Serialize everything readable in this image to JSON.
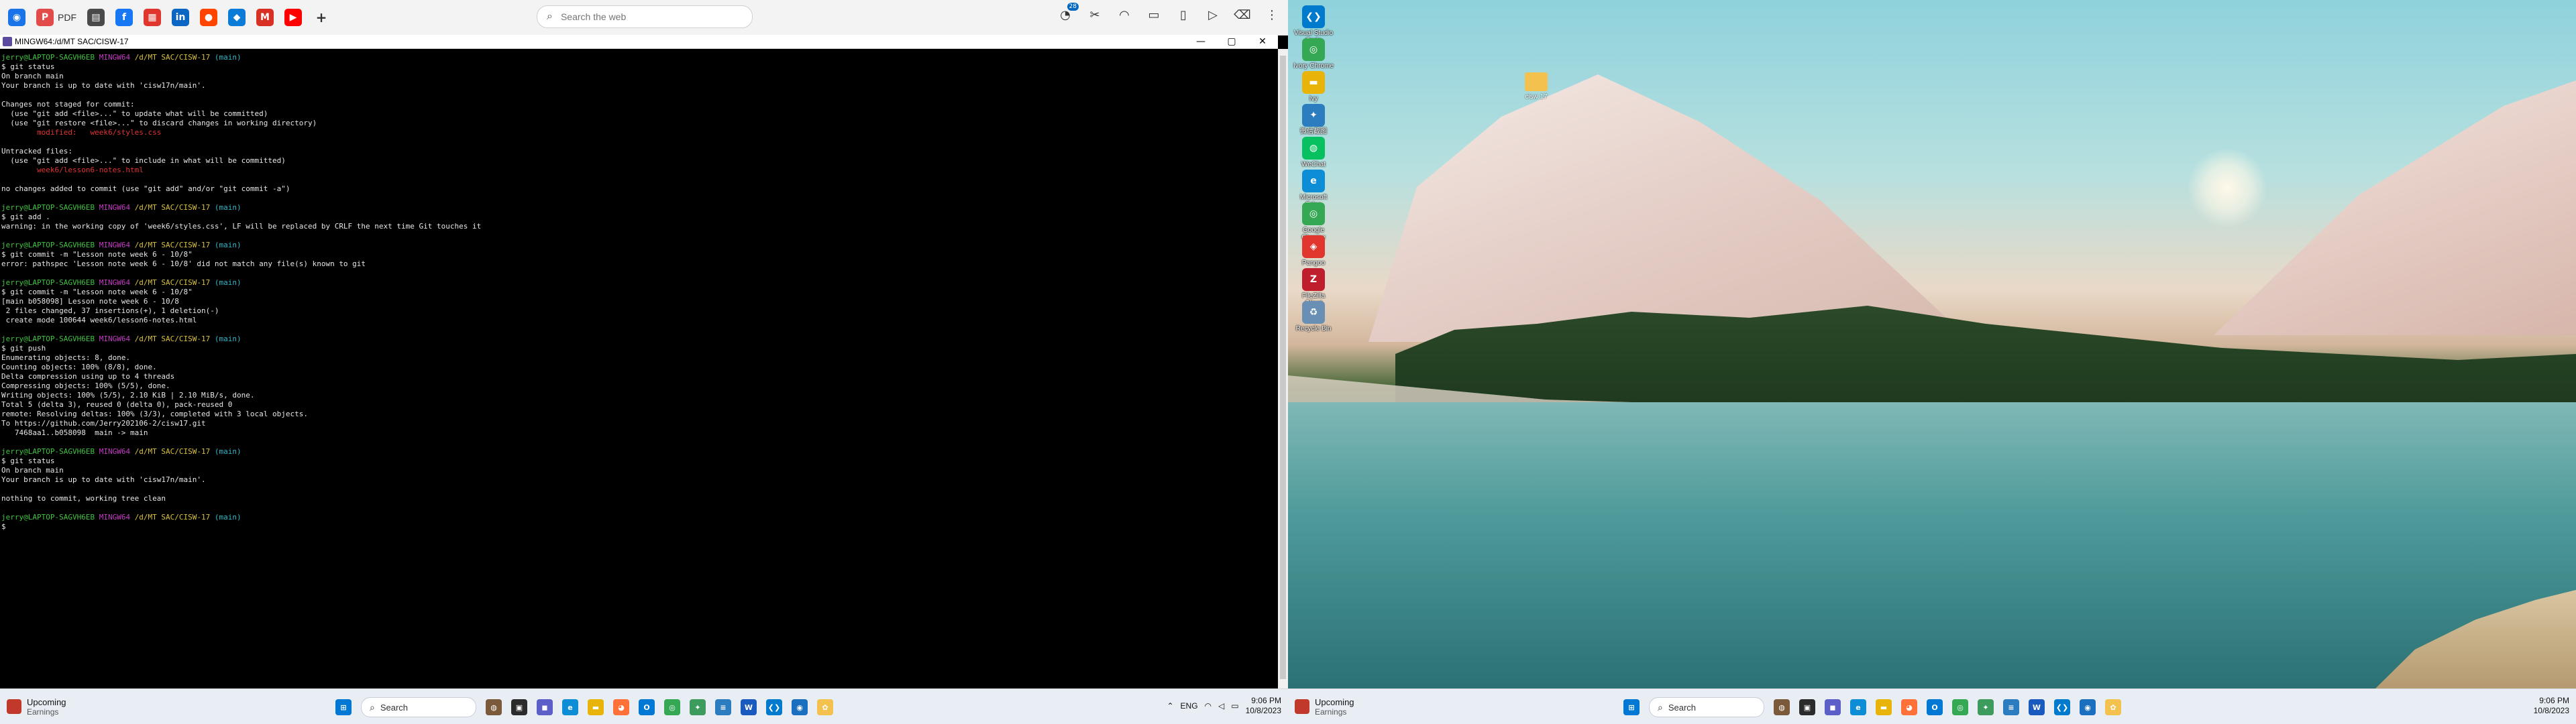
{
  "left_monitor": {
    "topbar": {
      "app_icons": [
        {
          "name": "circle-app-icon",
          "glyph": "◉",
          "color": "#1a73e8"
        },
        {
          "name": "pdf-icon",
          "glyph": "P",
          "color": "#e34b4b"
        },
        {
          "name": "sidebar-icon",
          "glyph": "▤",
          "color": "#4a4a4a"
        },
        {
          "name": "facebook-icon",
          "glyph": "f",
          "color": "#1877f2"
        },
        {
          "name": "news-icon",
          "glyph": "▦",
          "color": "#e0362d"
        },
        {
          "name": "linkedin-icon",
          "glyph": "in",
          "color": "#0a66c2"
        },
        {
          "name": "reddit-icon",
          "glyph": "●",
          "color": "#ff4500"
        },
        {
          "name": "blue-app-icon",
          "glyph": "◆",
          "color": "#0b7bd8"
        },
        {
          "name": "gmail-icon",
          "glyph": "M",
          "color": "#d93025"
        },
        {
          "name": "youtube-icon",
          "glyph": "▶",
          "color": "#ff0000"
        }
      ],
      "pdf_label": "PDF",
      "add_tab_glyph": "+",
      "search": {
        "placeholder": "Search the web"
      },
      "notification_count": "28"
    },
    "terminal": {
      "title": "MINGW64:/d/MT SAC/CISW-17",
      "controls": [
        "—",
        "▢",
        "✕"
      ],
      "prompt_user": "jerry@LAPTOP-SAGVH6EB",
      "prompt_shell": "MINGW64",
      "prompt_path": "/d/MT SAC/CISW-17",
      "prompt_branch": "(main)",
      "lines": [
        {
          "type": "prompt"
        },
        {
          "type": "out",
          "text": "$ git status"
        },
        {
          "type": "out",
          "text": "On branch main"
        },
        {
          "type": "out",
          "text": "Your branch is up to date with 'cisw17n/main'."
        },
        {
          "type": "out",
          "text": ""
        },
        {
          "type": "out",
          "text": "Changes not staged for commit:"
        },
        {
          "type": "out",
          "text": "  (use \"git add <file>...\" to update what will be committed)"
        },
        {
          "type": "out",
          "text": "  (use \"git restore <file>...\" to discard changes in working directory)"
        },
        {
          "type": "red",
          "text": "        modified:   week6/styles.css"
        },
        {
          "type": "out",
          "text": ""
        },
        {
          "type": "out",
          "text": "Untracked files:"
        },
        {
          "type": "out",
          "text": "  (use \"git add <file>...\" to include in what will be committed)"
        },
        {
          "type": "red",
          "text": "        week6/lesson6-notes.html"
        },
        {
          "type": "out",
          "text": ""
        },
        {
          "type": "out",
          "text": "no changes added to commit (use \"git add\" and/or \"git commit -a\")"
        },
        {
          "type": "out",
          "text": ""
        },
        {
          "type": "prompt"
        },
        {
          "type": "out",
          "text": "$ git add ."
        },
        {
          "type": "out",
          "text": "warning: in the working copy of 'week6/styles.css', LF will be replaced by CRLF the next time Git touches it"
        },
        {
          "type": "out",
          "text": ""
        },
        {
          "type": "prompt"
        },
        {
          "type": "out",
          "text": "$ git commit -m \"Lesson note week 6 - 10/8\""
        },
        {
          "type": "out",
          "text": "error: pathspec 'Lesson note week 6 - 10/8' did not match any file(s) known to git"
        },
        {
          "type": "out",
          "text": ""
        },
        {
          "type": "prompt"
        },
        {
          "type": "out",
          "text": "$ git commit -m \"Lesson note week 6 - 10/8\""
        },
        {
          "type": "out",
          "text": "[main b058098] Lesson note week 6 - 10/8"
        },
        {
          "type": "out",
          "text": " 2 files changed, 37 insertions(+), 1 deletion(-)"
        },
        {
          "type": "out",
          "text": " create mode 100644 week6/lesson6-notes.html"
        },
        {
          "type": "out",
          "text": ""
        },
        {
          "type": "prompt"
        },
        {
          "type": "out",
          "text": "$ git push"
        },
        {
          "type": "out",
          "text": "Enumerating objects: 8, done."
        },
        {
          "type": "out",
          "text": "Counting objects: 100% (8/8), done."
        },
        {
          "type": "out",
          "text": "Delta compression using up to 4 threads"
        },
        {
          "type": "out",
          "text": "Compressing objects: 100% (5/5), done."
        },
        {
          "type": "out",
          "text": "Writing objects: 100% (5/5), 2.10 KiB | 2.10 MiB/s, done."
        },
        {
          "type": "out",
          "text": "Total 5 (delta 3), reused 0 (delta 0), pack-reused 0"
        },
        {
          "type": "out",
          "text": "remote: Resolving deltas: 100% (3/3), completed with 3 local objects."
        },
        {
          "type": "out",
          "text": "To https://github.com/Jerry202106-2/cisw17.git"
        },
        {
          "type": "out",
          "text": "   7468aa1..b058098  main -> main"
        },
        {
          "type": "out",
          "text": ""
        },
        {
          "type": "prompt"
        },
        {
          "type": "out",
          "text": "$ git status"
        },
        {
          "type": "out",
          "text": "On branch main"
        },
        {
          "type": "out",
          "text": "Your branch is up to date with 'cisw17n/main'."
        },
        {
          "type": "out",
          "text": ""
        },
        {
          "type": "out",
          "text": "nothing to commit, working tree clean"
        },
        {
          "type": "out",
          "text": ""
        },
        {
          "type": "prompt"
        },
        {
          "type": "out",
          "text": "$"
        }
      ]
    },
    "taskbar": {
      "weather_title": "Upcoming",
      "weather_sub": "Earnings",
      "search_label": "Search",
      "icons": [
        {
          "name": "start-icon",
          "glyph": "⊞",
          "color": "#0078d4"
        },
        {
          "name": "cat-icon",
          "glyph": "◍",
          "color": "#7a5a3a"
        },
        {
          "name": "taskview-icon",
          "glyph": "▣",
          "color": "#2b2b2b"
        },
        {
          "name": "chat-icon",
          "glyph": "◼",
          "color": "#5b5fc7"
        },
        {
          "name": "edge-icon",
          "glyph": "e",
          "color": "#0c8dd6"
        },
        {
          "name": "explorer-icon",
          "glyph": "▬",
          "color": "#e8b40a"
        },
        {
          "name": "firefox-icon",
          "glyph": "◕",
          "color": "#ff7139"
        },
        {
          "name": "outlook-icon",
          "glyph": "O",
          "color": "#0078d4"
        },
        {
          "name": "chrome-icon",
          "glyph": "◎",
          "color": "#34a853"
        },
        {
          "name": "bird-icon",
          "glyph": "✦",
          "color": "#3d9b5e"
        },
        {
          "name": "notepad-icon",
          "glyph": "≡",
          "color": "#2c7cc0"
        },
        {
          "name": "word-icon",
          "glyph": "W",
          "color": "#185abd"
        },
        {
          "name": "vscode-icon",
          "glyph": "❮❯",
          "color": "#007acc"
        },
        {
          "name": "teams-icon",
          "glyph": "◉",
          "color": "#1c6fbf"
        },
        {
          "name": "paint-icon",
          "glyph": "✿",
          "color": "#f2c14e"
        }
      ],
      "tray": {
        "lang": "ENG",
        "time": "9:06 PM",
        "date": "10/8/2023"
      }
    }
  },
  "right_monitor": {
    "desktop_icons": [
      {
        "label": "Visual Studio Code",
        "color": "#007acc",
        "glyph": "❮❯"
      },
      {
        "label": "Ivory Chrome",
        "color": "#34a853",
        "glyph": "◎"
      },
      {
        "label": "Ivy",
        "color": "#e8b40a",
        "glyph": "▬"
      },
      {
        "label": "微信截图",
        "color": "#2c7cc0",
        "glyph": "✦"
      },
      {
        "label": "WeChat",
        "color": "#07c160",
        "glyph": "◍"
      },
      {
        "label": "Microsoft Edge",
        "color": "#0c8dd6",
        "glyph": "e"
      },
      {
        "label": "Google Chrome",
        "color": "#34a853",
        "glyph": "◎"
      },
      {
        "label": "Pangoo",
        "color": "#e0362d",
        "glyph": "◈"
      },
      {
        "label": "FileZilla Client",
        "color": "#bf1e2d",
        "glyph": "Z"
      },
      {
        "label": "Recycle Bin",
        "color": "#6a8fb5",
        "glyph": "♻"
      }
    ],
    "folder_label": "cisw 17",
    "taskbar": {
      "weather_title": "Upcoming",
      "weather_sub": "Earnings",
      "search_label": "Search",
      "time": "9:06 PM",
      "date": "10/8/2023"
    }
  }
}
